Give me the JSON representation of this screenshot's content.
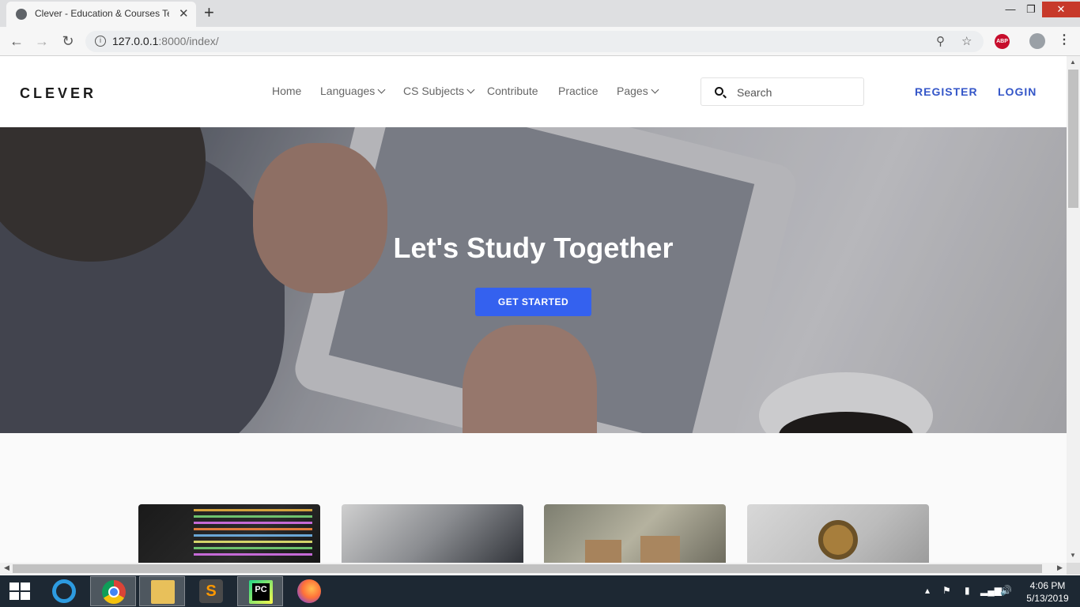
{
  "browser": {
    "tab_title": "Clever - Education & Courses Te",
    "url_host": "127.0.0.1",
    "url_rest": ":8000/index/",
    "new_tab": "+",
    "close_tab": "✕",
    "abp_label": "ABP"
  },
  "site": {
    "logo": "CLEVER",
    "nav": {
      "home": "Home",
      "languages": "Languages",
      "cs_subjects": "CS Subjects",
      "contribute": "Contribute",
      "practice": "Practice",
      "pages": "Pages"
    },
    "search": {
      "placeholder": "Search"
    },
    "register": "REGISTER",
    "login": "LOGIN",
    "hero": {
      "title": "Let's Study Together",
      "cta": "GET STARTED"
    }
  },
  "taskbar": {
    "time": "4:06 PM",
    "date": "5/13/2019"
  },
  "colors": {
    "accent": "#3461ef",
    "auth_link": "#3456c8",
    "taskbar": "#1d2833"
  }
}
